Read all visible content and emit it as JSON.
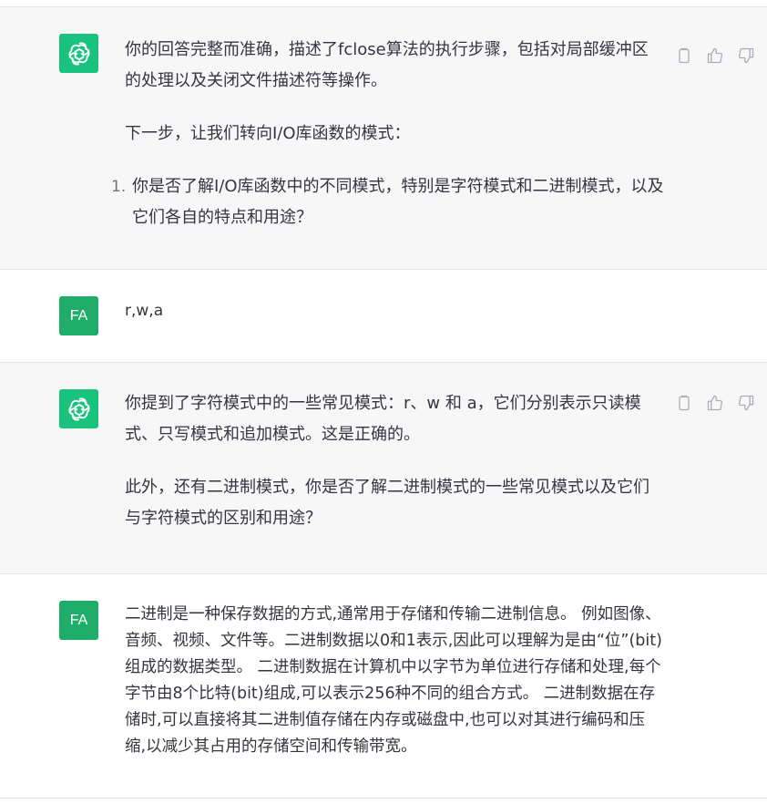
{
  "conversation": {
    "messages": [
      {
        "role": "assistant",
        "paragraphs": [
          "你的回答完整而准确，描述了fclose算法的执行步骤，包括对局部缓冲区的处理以及关闭文件描述符等操作。",
          "下一步，让我们转向I/O库函数的模式："
        ],
        "list_items": [
          {
            "number": "1.",
            "text": "你是否了解I/O库函数中的不同模式，特别是字符模式和二进制模式，以及它们各自的特点和用途？"
          }
        ]
      },
      {
        "role": "user",
        "avatar_initials": "FA",
        "text": "r,w,a"
      },
      {
        "role": "assistant",
        "paragraphs": [
          "你提到了字符模式中的一些常见模式：r、w 和 a，它们分别表示只读模式、只写模式和追加模式。这是正确的。",
          "此外，还有二进制模式，你是否了解二进制模式的一些常见模式以及它们与字符模式的区别和用途？"
        ]
      },
      {
        "role": "user",
        "avatar_initials": "FA",
        "text": "二进制是一种保存数据的方式,通常用于存储和传输二进制信息。 例如图像、音频、视频、文件等。二进制数据以0和1表示,因此可以理解为是由“位”(bit)组成的数据类型。 二进制数据在计算机中以字节为单位进行存储和处理,每个字节由8个比特(bit)组成,可以表示256种不同的组合方式。 二进制数据在存储时,可以直接将其二进制值存储在内存或磁盘中,也可以对其进行编码和压缩,以减少其占用的存储空间和传输带宽。"
      }
    ],
    "action_icons": [
      "copy-icon",
      "thumbs-up-icon",
      "thumbs-down-icon"
    ]
  },
  "theme": {
    "assistant_bg": "#f7f7f8",
    "user_bg": "#ffffff",
    "bot_avatar_color": "#19c37d",
    "user_avatar_color": "#1fae6a",
    "text_color": "#343541",
    "icon_color": "#acacbe"
  }
}
